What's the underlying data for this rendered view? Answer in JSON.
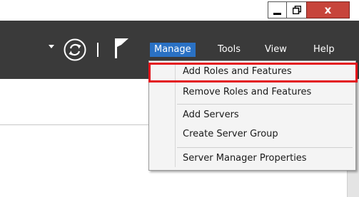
{
  "window_controls": {
    "minimize_icon": "minimize-icon",
    "restore_icon": "restore-icon",
    "close_label": "x",
    "close_color": "#c7443b"
  },
  "toolbar": {
    "background": "#3a3a3a",
    "icons": [
      "dropdown-caret-icon",
      "refresh-icon",
      "flag-icon"
    ]
  },
  "menu": {
    "items": [
      {
        "label": "Manage",
        "active": true
      },
      {
        "label": "Tools"
      },
      {
        "label": "View"
      },
      {
        "label": "Help"
      }
    ],
    "active_color": "#2a71c4"
  },
  "dropdown": {
    "items": [
      {
        "label": "Add Roles and Features",
        "highlighted": true
      },
      {
        "label": "Remove Roles and Features"
      },
      {
        "label": "Add Servers"
      },
      {
        "label": "Create Server Group"
      },
      {
        "label": "Server Manager Properties"
      }
    ],
    "highlight_color": "#e3141c"
  }
}
